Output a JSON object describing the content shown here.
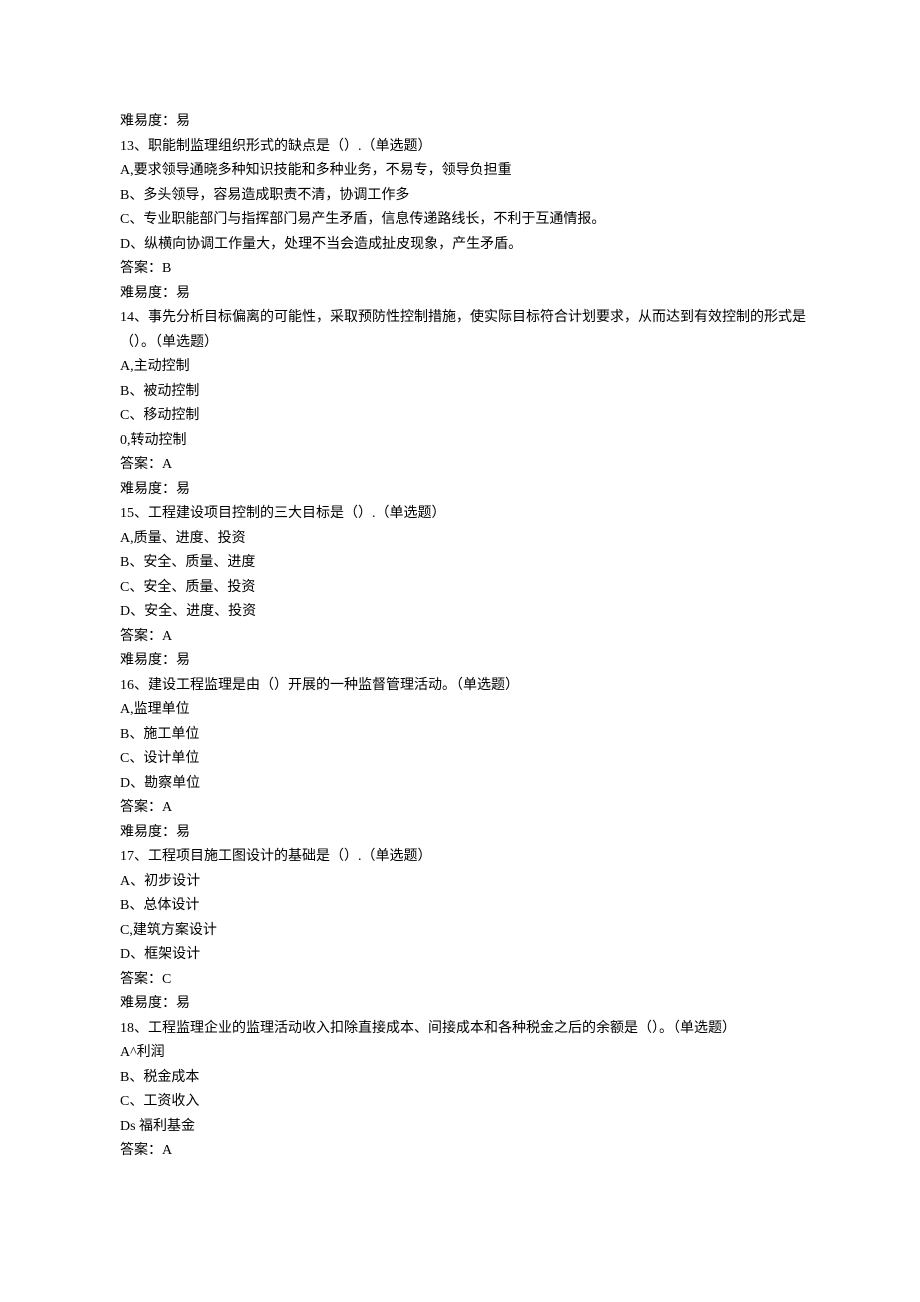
{
  "lines": [
    "难易度：易",
    "13、职能制监理组织形式的缺点是（）.（单选题）",
    "A,要求领导通晓多种知识技能和多种业务，不易专，领导负担重",
    "B、多头领导，容易造成职责不清，协调工作多",
    "C、专业职能部门与指挥部门易产生矛盾，信息传递路线长，不利于互通情报。",
    "D、纵横向协调工作量大，处理不当会造成扯皮现象，产生矛盾。",
    "答案：B",
    "难易度：易",
    "14、事先分析目标偏离的可能性，采取预防性控制措施，使实际目标符合计划要求，从而达到有效控制的形式是（）。（单选题）",
    "A,主动控制",
    "B、被动控制",
    "C、移动控制",
    "0,转动控制",
    "答案：A",
    "难易度：易",
    "15、工程建设项目控制的三大目标是（）.（单选题）",
    "A,质量、进度、投资",
    "B、安全、质量、进度",
    "C、安全、质量、投资",
    "D、安全、进度、投资",
    "答案：A",
    "难易度：易",
    "16、建设工程监理是由（）开展的一种监督管理活动。（单选题）",
    "A,监理单位",
    "B、施工单位",
    "C、设计单位",
    "D、勘察单位",
    "答案：A",
    "难易度：易",
    "17、工程项目施工图设计的基础是（）.（单选题）",
    "A、初步设计",
    "B、总体设计",
    "C,建筑方案设计",
    "D、框架设计",
    "答案：C",
    "难易度：易",
    "18、工程监理企业的监理活动收入扣除直接成本、间接成本和各种税金之后的余额是（）。（单选题）",
    "A^利润",
    "B、税金成本",
    "C、工资收入",
    "Ds 福利基金",
    "答案：A"
  ]
}
